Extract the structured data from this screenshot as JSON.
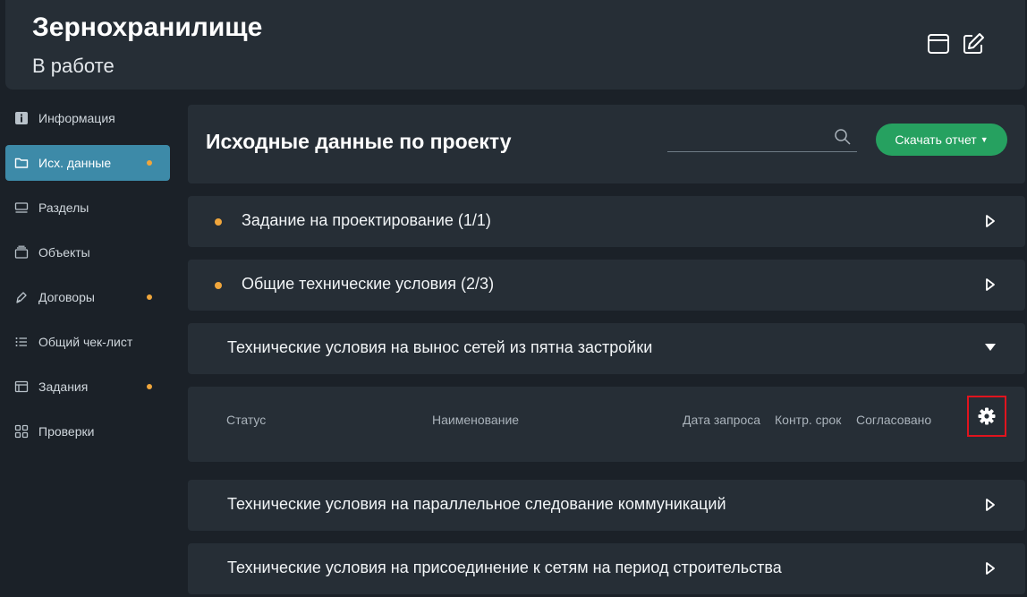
{
  "header": {
    "title": "Зернохранилище",
    "status": "В работе"
  },
  "sidebar": {
    "items": [
      {
        "label": "Информация",
        "icon": "info-icon",
        "active": false,
        "dot": false
      },
      {
        "label": "Исх. данные",
        "icon": "folder-icon",
        "active": true,
        "dot": true
      },
      {
        "label": "Разделы",
        "icon": "sections-icon",
        "active": false,
        "dot": false
      },
      {
        "label": "Объекты",
        "icon": "stack-icon",
        "active": false,
        "dot": false
      },
      {
        "label": "Договоры",
        "icon": "pen-icon",
        "active": false,
        "dot": true
      },
      {
        "label": "Общий чек-лист",
        "icon": "checklist-icon",
        "active": false,
        "dot": false
      },
      {
        "label": "Задания",
        "icon": "tasks-icon",
        "active": false,
        "dot": true
      },
      {
        "label": "Проверки",
        "icon": "grid-icon",
        "active": false,
        "dot": false
      }
    ]
  },
  "main": {
    "title": "Исходные данные по проекту",
    "search_value": "",
    "download_label": "Скачать отчет",
    "sections": [
      {
        "label": "Задание на проектирование (1/1)",
        "dot": true,
        "expanded": false
      },
      {
        "label": "Общие технические условия (2/3)",
        "dot": true,
        "expanded": false
      },
      {
        "label": "Технические условия на вынос сетей из пятна застройки",
        "dot": false,
        "expanded": true
      },
      {
        "label": "Технические условия на параллельное следование коммуникаций",
        "dot": false,
        "expanded": false
      },
      {
        "label": "Технические условия на присоединение к сетям на период строительства",
        "dot": false,
        "expanded": false
      }
    ],
    "table_columns": [
      "Статус",
      "Наименование",
      "Дата запроса",
      "Контр. срок",
      "Согласовано"
    ]
  },
  "colors": {
    "background": "#1b2128",
    "panel": "#262e36",
    "accent": "#3d8aa8",
    "button": "#26a160",
    "dot": "#f0a63c",
    "highlight": "#e0141e"
  }
}
